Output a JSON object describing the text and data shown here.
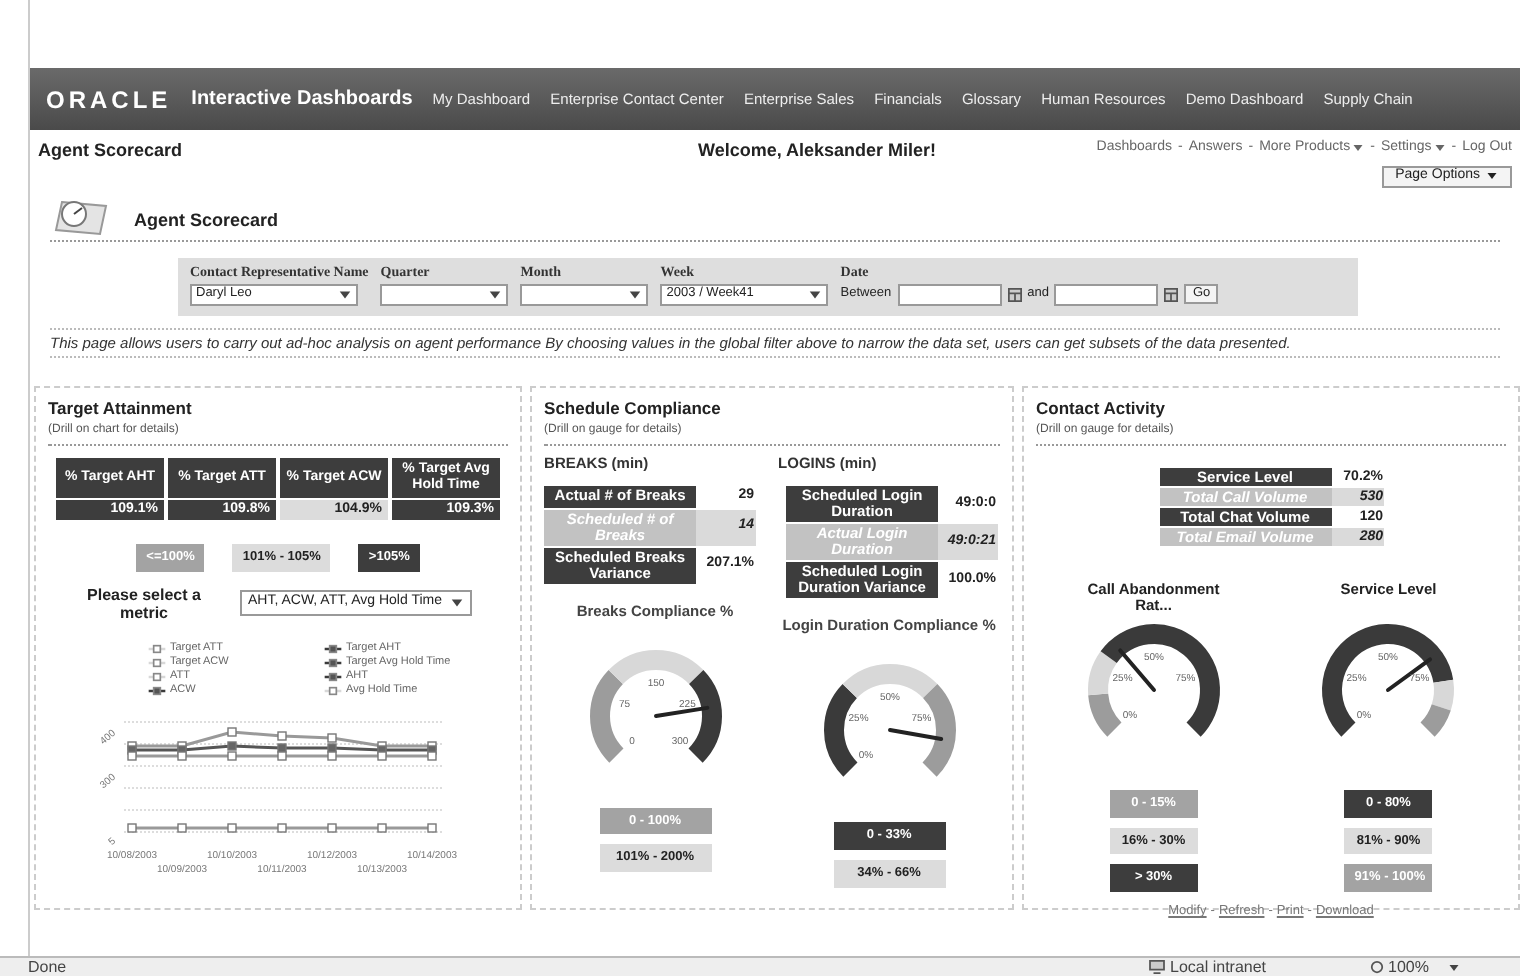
{
  "header": {
    "logo": "ORACLE",
    "product": "Interactive Dashboards",
    "nav": [
      "My Dashboard",
      "Enterprise Contact Center",
      "Enterprise Sales",
      "Financials",
      "Glossary",
      "Human Resources",
      "Demo Dashboard",
      "Supply Chain"
    ]
  },
  "page_title": "Agent Scorecard",
  "welcome": "Welcome, Aleksander Miler!",
  "top_links": [
    {
      "label": "Dashboards",
      "caret": false
    },
    {
      "label": "Answers",
      "caret": false
    },
    {
      "label": "More Products",
      "caret": true
    },
    {
      "label": "Settings",
      "caret": true
    },
    {
      "label": "Log Out",
      "caret": false
    }
  ],
  "link_separator": "-",
  "page_options": "Page Options",
  "section_title": "Agent Scorecard",
  "filters": [
    {
      "label": "Contact Representative Name",
      "kind": "select",
      "value": "Daryl Leo"
    },
    {
      "label": "Quarter",
      "kind": "select"
    },
    {
      "label": "Month",
      "kind": "select"
    },
    {
      "label": "Week",
      "kind": "select",
      "value": "2003 / Week41"
    },
    {
      "label": "Date",
      "kind": "date_range",
      "between": "Between",
      "and": "and"
    }
  ],
  "go": "Go",
  "description": "This page allows users to carry out ad-hoc analysis on agent performance  By choosing values in the global filter above to narrow the data set, users can get subsets of the data presented.",
  "target_attainment": {
    "title": "Target Attainment",
    "subtitle": "(Drill on chart for details)",
    "headers": [
      "% Target AHT",
      "% Target ATT",
      "% Target ACW",
      "% Target Avg Hold Time"
    ],
    "values": [
      {
        "text": "109.1%",
        "kind": "dark"
      },
      {
        "text": "109.8%",
        "kind": "dark"
      },
      {
        "text": "104.9%",
        "kind": "light"
      },
      {
        "text": "109.3%",
        "kind": "dark"
      }
    ],
    "ranges": [
      {
        "label": "<=100%",
        "kind": "mid"
      },
      {
        "label": "101% - 105%",
        "kind": "light"
      },
      {
        "label": ">105%",
        "kind": "dark"
      }
    ],
    "metric_label": "Please select a metric",
    "metric_value": "AHT, ACW, ATT, Avg Hold Time",
    "legend": [
      {
        "label": "Target ATT",
        "kind": "light"
      },
      {
        "label": "Target AHT",
        "kind": "dark"
      },
      {
        "label": "Target ACW",
        "kind": "light"
      },
      {
        "label": "Target Avg Hold Time",
        "kind": "dark"
      },
      {
        "label": "ATT",
        "kind": "light"
      },
      {
        "label": "AHT",
        "kind": "dark"
      },
      {
        "label": "ACW",
        "kind": "dark"
      },
      {
        "label": "Avg Hold Time",
        "kind": "light"
      }
    ],
    "y_labels": [
      "400",
      "300",
      "5"
    ],
    "x_labels_top": [
      "10/08/2003",
      "10/10/2003",
      "10/12/2003",
      "10/14/2003"
    ],
    "x_labels_bottom": [
      "10/09/2003",
      "10/11/2003",
      "10/13/2003"
    ]
  },
  "schedule_compliance": {
    "title": "Schedule Compliance",
    "subtitle": "(Drill on gauge for details)",
    "groups": [
      {
        "heading": "BREAKS (min)",
        "rows": [
          {
            "label": "Actual # of Breaks",
            "value": "29",
            "kind": "dark"
          },
          {
            "label": "Scheduled # of Breaks",
            "value": "14",
            "kind": "light"
          },
          {
            "label": "Scheduled Breaks Variance",
            "value": "207.1%",
            "kind": "dark"
          }
        ],
        "gauge": {
          "title": "Breaks Compliance %",
          "ticks": [
            "0",
            "75",
            "150",
            "225",
            "300"
          ]
        },
        "ranges": [
          {
            "label": "0 - 100%",
            "kind": "mid"
          },
          {
            "label": "101% - 200%",
            "kind": "light"
          }
        ]
      },
      {
        "heading": "LOGINS (min)",
        "rows": [
          {
            "label": "Scheduled Login Duration",
            "value": "49:0:0",
            "kind": "dark"
          },
          {
            "label": "Actual Login Duration",
            "value": "49:0:21",
            "kind": "light"
          },
          {
            "label": "Scheduled Login Duration Variance",
            "value": "100.0%",
            "kind": "dark"
          }
        ],
        "gauge": {
          "title": "Login Duration Compliance %",
          "ticks": [
            "0%",
            "25%",
            "50%",
            "75%"
          ]
        },
        "ranges": [
          {
            "label": "0 - 33%",
            "kind": "dark"
          },
          {
            "label": "34% - 66%",
            "kind": "light"
          }
        ]
      }
    ]
  },
  "contact_activity": {
    "title": "Contact Activity",
    "subtitle": "(Drill on gauge for details)",
    "rows": [
      {
        "label": "Service Level",
        "value": "70.2%",
        "kind": "dark"
      },
      {
        "label": "Total Call Volume",
        "value": "530",
        "kind": "light"
      },
      {
        "label": "Total Chat Volume",
        "value": "120",
        "kind": "dark"
      },
      {
        "label": "Total Email Volume",
        "value": "280",
        "kind": "light"
      }
    ],
    "gauges": [
      {
        "title": "Call Abandonment Rat...",
        "ticks": [
          "0%",
          "25%",
          "50%",
          "75%"
        ],
        "ranges": [
          {
            "label": "0 - 15%",
            "kind": "mid"
          },
          {
            "label": "16% - 30%",
            "kind": "light"
          },
          {
            "label": "> 30%",
            "kind": "dark"
          }
        ]
      },
      {
        "title": "Service Level",
        "ticks": [
          "0%",
          "25%",
          "50%",
          "75%"
        ],
        "ranges": [
          {
            "label": "0 - 80%",
            "kind": "dark"
          },
          {
            "label": "81% - 90%",
            "kind": "light"
          },
          {
            "label": "91% - 100%",
            "kind": "mid"
          }
        ]
      }
    ],
    "links": [
      "Modify",
      "Refresh",
      "Print",
      "Download"
    ]
  },
  "status_bar": {
    "left": "Done",
    "zone": "Local intranet",
    "zoom": "100%"
  }
}
